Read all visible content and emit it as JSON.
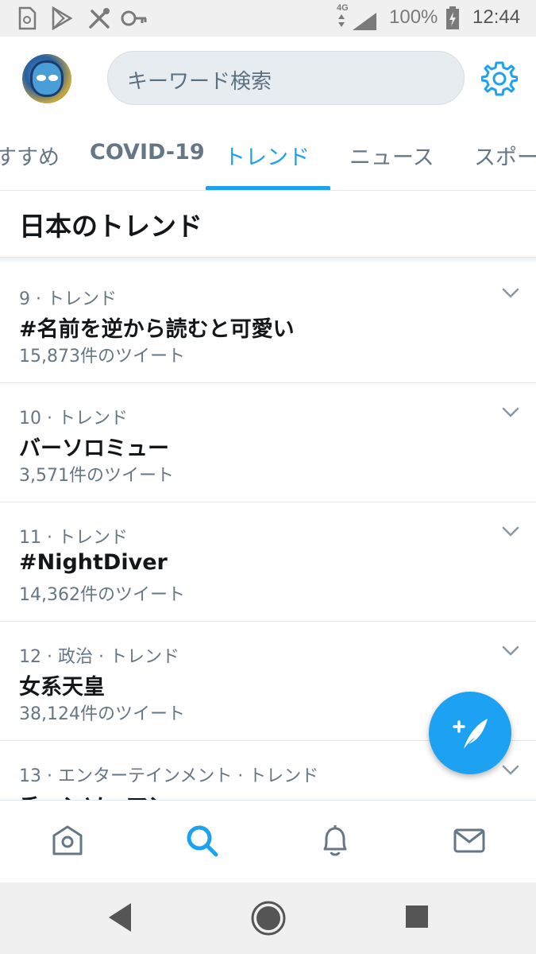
{
  "status_bar": {
    "network": "4G",
    "battery": "100%",
    "time": "12:44",
    "icons": [
      "sim-card-icon",
      "play-store-icon",
      "tools-icon",
      "key-icon",
      "signal-icon",
      "battery-charging-icon"
    ]
  },
  "header": {
    "search_placeholder": "キーワード検索",
    "settings_icon": "gear-icon"
  },
  "tabs": [
    {
      "label": "すすめ",
      "active": false
    },
    {
      "label": "COVID-19",
      "active": false
    },
    {
      "label": "トレンド",
      "active": true
    },
    {
      "label": "ニュース",
      "active": false
    },
    {
      "label": "スポー",
      "active": false
    }
  ],
  "section": {
    "title": "日本のトレンド"
  },
  "trends": [
    {
      "meta": "9 · トレンド",
      "name": "#名前を逆から読むと可愛い",
      "count": "15,873件のツイート"
    },
    {
      "meta": "10 · トレンド",
      "name": "バーソロミュー",
      "count": "3,571件のツイート"
    },
    {
      "meta": "11 · トレンド",
      "name": "#NightDiver",
      "count": "14,362件のツイート"
    },
    {
      "meta": "12 · 政治 · トレンド",
      "name": "女系天皇",
      "count": "38,124件のツイート"
    },
    {
      "meta": "13 · エンターテインメント · トレンド",
      "name": "チェンソーマン",
      "count": ""
    }
  ],
  "bottom_nav": [
    "home-icon",
    "search-icon",
    "notifications-icon",
    "messages-icon"
  ],
  "colors": {
    "accent": "#1da1f2",
    "text_primary": "#14171a",
    "text_secondary": "#657786"
  }
}
